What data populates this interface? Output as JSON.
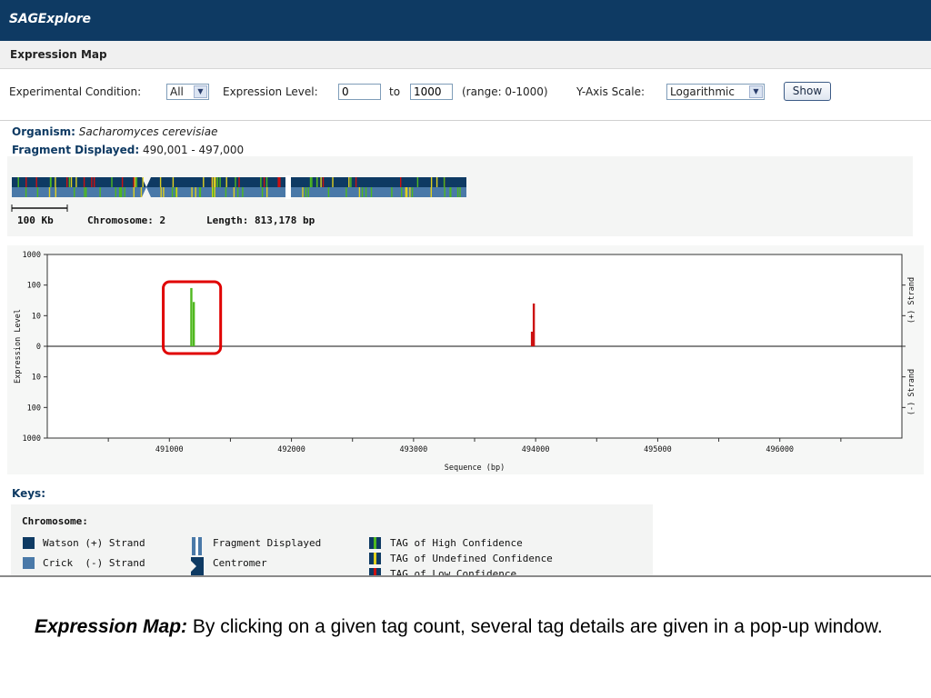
{
  "app": {
    "title": "SAGExplore"
  },
  "section": {
    "title": "Expression Map"
  },
  "controls": {
    "condition_label": "Experimental Condition:",
    "condition_value": "All",
    "level_label": "Expression Level:",
    "level_from": "0",
    "to_label": "to",
    "level_to": "1000",
    "range_text": "(range: 0-1000)",
    "scale_label": "Y-Axis Scale:",
    "scale_value": "Logarithmic",
    "show_button": "Show"
  },
  "info": {
    "organism_label": "Organism:",
    "organism_value": "Sacharomyces cerevisiae",
    "fragment_label": "Fragment Displayed:",
    "fragment_value": "490,001 - 497,000",
    "scale_text": "100 Kb",
    "chromosome_text": "Chromosome: 2",
    "length_text": "Length: 813,178 bp"
  },
  "chart_data": {
    "type": "bar",
    "title": "",
    "xlabel": "Sequence (bp)",
    "ylabel": "Expression Level",
    "x_ticks": [
      "491000",
      "492000",
      "493000",
      "494000",
      "495000",
      "496000"
    ],
    "y_ticks_top": [
      "1000",
      "100",
      "10",
      "0"
    ],
    "y_ticks_bottom": [
      "10",
      "100",
      "1000"
    ],
    "right_labels": [
      "(+) Strand",
      "(-) Strand"
    ],
    "xlim": [
      490000,
      497000
    ],
    "y_scale": "log",
    "ylim": [
      0,
      1000
    ],
    "grid": false,
    "series": [
      {
        "strand": "+",
        "color": "#4fb81f",
        "tags": [
          {
            "x": 491180,
            "value": 80
          },
          {
            "x": 491200,
            "value": 28
          }
        ]
      },
      {
        "strand": "+",
        "color": "#cc1010",
        "tags": [
          {
            "x": 493970,
            "value": 3
          },
          {
            "x": 493985,
            "value": 25
          }
        ]
      }
    ],
    "highlight": {
      "x_from": 490950,
      "x_to": 491420,
      "color": "#e00000"
    }
  },
  "keys": {
    "title": "Keys:",
    "chromosome_label": "Chromosome:",
    "watson": "Watson (+) Strand",
    "crick": "Crick  (-) Strand",
    "fragment": "Fragment Displayed",
    "centromere": "Centromer",
    "tag_high": "TAG of High Confidence",
    "tag_undefined": "TAG of Undefined Confidence",
    "tag_low": "TAG of Low Confidence",
    "colors": {
      "watson": "#0e3a63",
      "crick": "#4a79a8"
    }
  },
  "caption": {
    "lead": "Expression Map:",
    "text": " By clicking on a given tag count, several tag details are given in a pop-up window."
  }
}
